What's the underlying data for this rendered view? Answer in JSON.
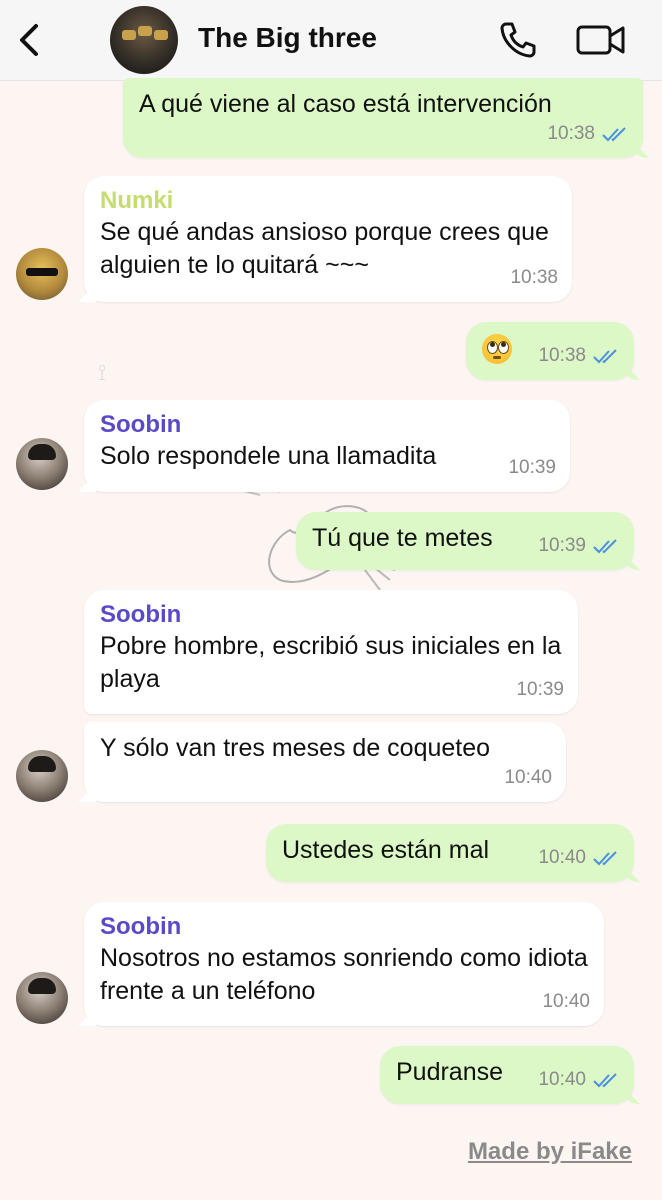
{
  "header": {
    "title": "The Big three",
    "icons": [
      "back-chevron-icon",
      "group-avatar",
      "phone-icon",
      "video-camera-icon"
    ]
  },
  "colors": {
    "outgoing_bubble": "#dcf8c6",
    "incoming_bubble": "#ffffff",
    "numki_name": "#c5dc6e",
    "soobin_name": "#5a49c8",
    "read_ticks": "#4a90e2",
    "background": "#fdf5f2"
  },
  "messages": [
    {
      "direction": "out",
      "text": "A qué viene al caso está intervención",
      "time": "10:38",
      "status": "read"
    },
    {
      "direction": "in",
      "sender": "Numki",
      "text": "Se qué andas ansioso porque crees que alguien te lo quitará ~~~",
      "time": "10:38"
    },
    {
      "direction": "out",
      "text": "",
      "emoji": "face-with-rolling-eyes",
      "time": "10:38",
      "status": "read"
    },
    {
      "direction": "in",
      "sender": "Soobin",
      "text": "Solo respondele una llamadita",
      "time": "10:39"
    },
    {
      "direction": "out",
      "text": "Tú que te metes",
      "time": "10:39",
      "status": "read"
    },
    {
      "direction": "in",
      "sender": "Soobin",
      "text": "Pobre hombre, escribió sus iniciales en la playa",
      "time": "10:39"
    },
    {
      "direction": "in",
      "sender": "",
      "text": "Y sólo van tres meses de coqueteo",
      "time": "10:40"
    },
    {
      "direction": "out",
      "text": "Ustedes están mal",
      "time": "10:40",
      "status": "read"
    },
    {
      "direction": "in",
      "sender": "Soobin",
      "text": "Nosotros no estamos sonriendo como idiota frente a un teléfono",
      "time": "10:40"
    },
    {
      "direction": "out",
      "text": "Pudranse",
      "time": "10:40",
      "status": "read"
    }
  ],
  "watermark": "Made by iFake"
}
